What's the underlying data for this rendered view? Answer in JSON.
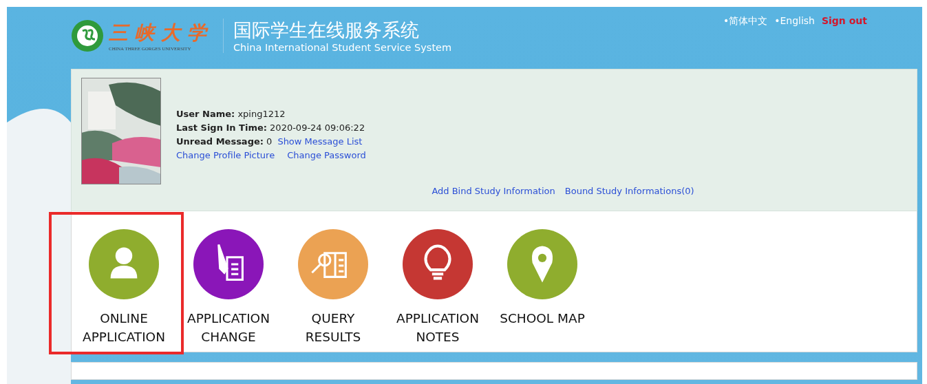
{
  "header": {
    "logo_name": "三峡大学",
    "logo_subtitle": "CHINA THREE GORGES UNIVERSITY",
    "title": "国际学生在线服务系统",
    "subtitle": "China International Student Service System"
  },
  "top_links": [
    {
      "label": "•简体中文",
      "kind": "lang"
    },
    {
      "label": "•English",
      "kind": "lang"
    },
    {
      "label": "Sign out",
      "kind": "signout"
    }
  ],
  "profile": {
    "fields": [
      {
        "label": "User Name:",
        "value": "xping1212"
      },
      {
        "label": "Last Sign In Time:",
        "value": "2020-09-24 09:06:22"
      },
      {
        "label": "Unread Message:",
        "value": "0",
        "link": "Show Message List"
      }
    ],
    "links": [
      "Change Profile Picture",
      "Change Password"
    ],
    "study_links": [
      "Add Bind Study Information",
      "Bound Study Informations(0)"
    ]
  },
  "tiles": [
    {
      "lines": [
        "ONLINE",
        "APPLICATION"
      ],
      "kind": "person",
      "color": "#8fad2e",
      "highlighted": true
    },
    {
      "lines": [
        "APPLICATION",
        "CHANGE"
      ],
      "kind": "pen",
      "color": "#8a16b8",
      "highlighted": false
    },
    {
      "lines": [
        "QUERY",
        "RESULTS"
      ],
      "kind": "book",
      "color": "#eba253",
      "highlighted": false
    },
    {
      "lines": [
        "APPLICATION",
        "NOTES"
      ],
      "kind": "bulb",
      "color": "#c53733",
      "highlighted": false
    },
    {
      "lines": [
        "SCHOOL MAP"
      ],
      "kind": "pin",
      "color": "#8fad2e",
      "highlighted": false
    }
  ]
}
